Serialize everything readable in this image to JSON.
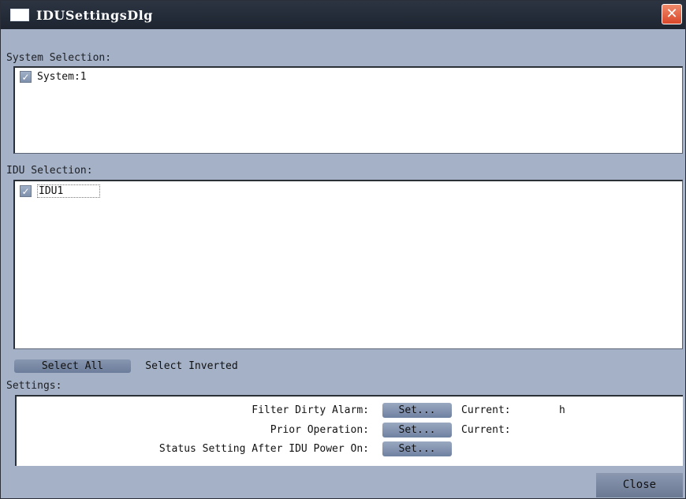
{
  "window": {
    "title": "IDUSettingsDlg"
  },
  "system_section": {
    "label": "System Selection:",
    "items": [
      {
        "label": "System:1",
        "checked": true
      }
    ]
  },
  "idu_section": {
    "label": "IDU Selection:",
    "items": [
      {
        "label": "IDU1",
        "checked": true
      }
    ]
  },
  "selection_buttons": {
    "select_all": "Select All",
    "select_inverted": "Select Inverted"
  },
  "settings": {
    "label": "Settings:",
    "rows": [
      {
        "label": "Filter Dirty Alarm:",
        "button": "Set...",
        "current_label": "Current:",
        "unit": "h"
      },
      {
        "label": "Prior Operation:",
        "button": "Set...",
        "current_label": "Current:"
      },
      {
        "label": "Status Setting After IDU Power On:",
        "button": "Set..."
      }
    ]
  },
  "footer": {
    "close_label": "Close"
  },
  "colors": {
    "titlebar": "#1e2531",
    "background": "#a4b1c6",
    "accent_button": "#7a8aa6",
    "close_x": "#d9472a"
  },
  "icons": {
    "close": "close-icon",
    "check": "checkmark-icon",
    "window": "window-icon"
  }
}
